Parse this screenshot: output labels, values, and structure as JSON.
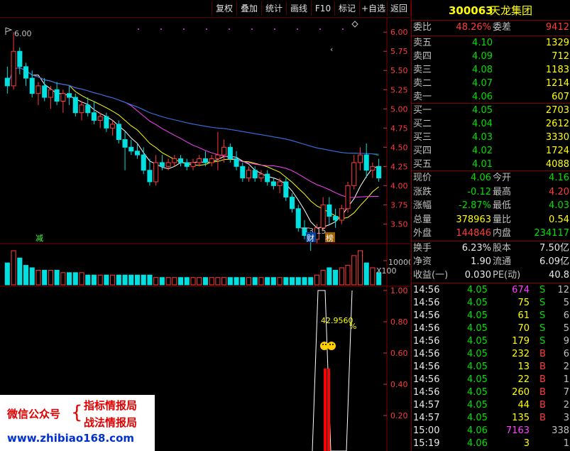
{
  "toolbar": {
    "buttons": [
      "复权",
      "叠加",
      "统计",
      "画线",
      "F10",
      "标记",
      "+自选",
      "返回"
    ]
  },
  "stock": {
    "code": "300063",
    "name": "天龙集团"
  },
  "order_ratio": {
    "label1": "委比",
    "value1": "48.26%",
    "label2": "委差",
    "value2": "9412"
  },
  "asks": [
    {
      "label": "卖五",
      "price": "4.10",
      "vol": "1329"
    },
    {
      "label": "卖四",
      "price": "4.09",
      "vol": "712"
    },
    {
      "label": "卖三",
      "price": "4.08",
      "vol": "1183"
    },
    {
      "label": "卖二",
      "price": "4.07",
      "vol": "1214"
    },
    {
      "label": "卖一",
      "price": "4.06",
      "vol": "607"
    }
  ],
  "bids": [
    {
      "label": "买一",
      "price": "4.05",
      "vol": "2703"
    },
    {
      "label": "买二",
      "price": "4.04",
      "vol": "2612"
    },
    {
      "label": "买三",
      "price": "4.03",
      "vol": "3330"
    },
    {
      "label": "买四",
      "price": "4.02",
      "vol": "1724"
    },
    {
      "label": "买五",
      "price": "4.01",
      "vol": "4088"
    }
  ],
  "quote": [
    {
      "l1": "现价",
      "v1": "4.06",
      "c1": "green",
      "l2": "今开",
      "v2": "4.16",
      "c2": "green"
    },
    {
      "l1": "涨跌",
      "v1": "-0.12",
      "c1": "green",
      "l2": "最高",
      "v2": "4.20",
      "c2": "red"
    },
    {
      "l1": "涨幅",
      "v1": "-2.87%",
      "c1": "green",
      "l2": "最低",
      "v2": "4.03",
      "c2": "green"
    },
    {
      "l1": "总量",
      "v1": "378963",
      "c1": "yellow",
      "l2": "量比",
      "v2": "0.54",
      "c2": "yellow"
    },
    {
      "l1": "外盘",
      "v1": "144846",
      "c1": "red",
      "l2": "内盘",
      "v2": "234117",
      "c2": "green"
    }
  ],
  "stats": [
    {
      "l1": "换手",
      "v1": "6.23%",
      "l2": "股本",
      "v2": "7.50亿"
    },
    {
      "l1": "净资",
      "v1": "1.90",
      "l2": "流通",
      "v2": "6.09亿"
    },
    {
      "l1": "收益(一)",
      "v1": "0.030",
      "l2": "PE(动)",
      "v2": "40.8"
    }
  ],
  "ticks": [
    {
      "time": "14:56",
      "price": "4.05",
      "vol": "674",
      "side": "S",
      "n": "12",
      "vcolor": "magenta"
    },
    {
      "time": "14:56",
      "price": "4.05",
      "vol": "75",
      "side": "S",
      "n": "5",
      "vcolor": "yellow"
    },
    {
      "time": "14:56",
      "price": "4.05",
      "vol": "61",
      "side": "S",
      "n": "6",
      "vcolor": "yellow"
    },
    {
      "time": "14:56",
      "price": "4.05",
      "vol": "70",
      "side": "S",
      "n": "5",
      "vcolor": "yellow"
    },
    {
      "time": "14:56",
      "price": "4.05",
      "vol": "179",
      "side": "S",
      "n": "9",
      "vcolor": "yellow"
    },
    {
      "time": "14:56",
      "price": "4.05",
      "vol": "232",
      "side": "B",
      "n": "6",
      "vcolor": "yellow"
    },
    {
      "time": "14:56",
      "price": "4.05",
      "vol": "13",
      "side": "B",
      "n": "2",
      "vcolor": "yellow"
    },
    {
      "time": "14:56",
      "price": "4.05",
      "vol": "22",
      "side": "B",
      "n": "1",
      "vcolor": "yellow"
    },
    {
      "time": "14:56",
      "price": "4.05",
      "vol": "260",
      "side": "B",
      "n": "7",
      "vcolor": "yellow"
    },
    {
      "time": "14:57",
      "price": "4.05",
      "vol": "44",
      "side": "B",
      "n": "2",
      "vcolor": "yellow"
    },
    {
      "time": "14:57",
      "price": "4.05",
      "vol": "135",
      "side": "B",
      "n": "3",
      "vcolor": "yellow"
    },
    {
      "time": "15:00",
      "price": "4.06",
      "vol": "7163",
      "side": "",
      "n": "338",
      "vcolor": "magenta"
    },
    {
      "time": "15:19",
      "price": "4.06",
      "vol": "3",
      "side": "",
      "n": "1",
      "vcolor": "yellow"
    }
  ],
  "chart_data": [
    {
      "type": "candlestick",
      "price_ticks": [
        "6.00",
        "5.75",
        "5.50",
        "5.25",
        "5.00",
        "4.75",
        "4.50",
        "4.25",
        "4.00",
        "3.75",
        "3.50"
      ],
      "ylim": [
        3.3,
        6.15
      ],
      "high_label": "6.00",
      "low_label": "3.15",
      "markers": [
        "减",
        "财",
        "榜"
      ],
      "ohlc": [
        [
          5.4,
          5.55,
          5.2,
          5.3
        ],
        [
          5.3,
          6.0,
          5.25,
          5.75
        ],
        [
          5.75,
          5.8,
          5.45,
          5.55
        ],
        [
          5.55,
          5.6,
          5.3,
          5.4
        ],
        [
          5.4,
          5.5,
          5.15,
          5.2
        ],
        [
          5.2,
          5.35,
          5.05,
          5.3
        ],
        [
          5.3,
          5.4,
          5.1,
          5.15
        ],
        [
          5.15,
          5.3,
          5.0,
          5.25
        ],
        [
          5.25,
          5.35,
          5.05,
          5.1
        ],
        [
          5.1,
          5.25,
          4.95,
          5.2
        ],
        [
          5.2,
          5.3,
          5.05,
          5.15
        ],
        [
          5.15,
          5.2,
          4.9,
          4.95
        ],
        [
          4.95,
          5.1,
          4.85,
          5.05
        ],
        [
          5.05,
          5.15,
          4.9,
          4.95
        ],
        [
          4.95,
          5.1,
          4.8,
          4.85
        ],
        [
          4.85,
          4.95,
          4.75,
          4.9
        ],
        [
          4.9,
          4.95,
          4.7,
          4.75
        ],
        [
          4.75,
          4.85,
          4.65,
          4.8
        ],
        [
          4.8,
          4.85,
          4.55,
          4.6
        ],
        [
          4.6,
          4.7,
          4.2,
          4.5
        ],
        [
          4.5,
          4.6,
          4.4,
          4.45
        ],
        [
          4.45,
          4.55,
          4.35,
          4.4
        ],
        [
          4.4,
          4.5,
          4.15,
          4.2
        ],
        [
          4.2,
          4.35,
          4.0,
          4.05
        ],
        [
          4.05,
          4.4,
          4.0,
          4.3
        ],
        [
          4.3,
          4.4,
          4.2,
          4.25
        ],
        [
          4.25,
          4.35,
          4.2,
          4.3
        ],
        [
          4.3,
          4.4,
          4.25,
          4.35
        ],
        [
          4.35,
          4.4,
          4.25,
          4.3
        ],
        [
          4.3,
          4.35,
          4.2,
          4.25
        ],
        [
          4.25,
          4.35,
          4.2,
          4.3
        ],
        [
          4.3,
          4.4,
          4.25,
          4.35
        ],
        [
          4.35,
          4.45,
          4.25,
          4.3
        ],
        [
          4.3,
          4.4,
          4.25,
          4.35
        ],
        [
          4.35,
          4.7,
          4.2,
          4.4
        ],
        [
          4.4,
          4.6,
          4.3,
          4.5
        ],
        [
          4.5,
          4.55,
          4.3,
          4.35
        ],
        [
          4.35,
          4.45,
          4.2,
          4.25
        ],
        [
          4.25,
          4.3,
          4.05,
          4.1
        ],
        [
          4.1,
          4.25,
          4.05,
          4.2
        ],
        [
          4.2,
          4.25,
          4.05,
          4.1
        ],
        [
          4.1,
          4.2,
          4.05,
          4.15
        ],
        [
          4.15,
          4.2,
          4.0,
          4.05
        ],
        [
          4.05,
          4.1,
          3.95,
          4.0
        ],
        [
          4.0,
          4.1,
          3.9,
          4.05
        ],
        [
          4.05,
          4.1,
          3.8,
          3.85
        ],
        [
          3.85,
          3.9,
          3.65,
          3.7
        ],
        [
          3.7,
          3.75,
          3.4,
          3.45
        ],
        [
          3.45,
          3.55,
          3.3,
          3.35
        ],
        [
          3.35,
          3.4,
          3.15,
          3.3
        ],
        [
          3.3,
          3.5,
          3.25,
          3.45
        ],
        [
          3.45,
          3.85,
          3.4,
          3.75
        ],
        [
          3.75,
          3.85,
          3.5,
          3.6
        ],
        [
          3.6,
          3.7,
          3.45,
          3.55
        ],
        [
          3.55,
          3.75,
          3.5,
          3.7
        ],
        [
          3.7,
          4.05,
          3.65,
          4.0
        ],
        [
          4.0,
          4.4,
          3.95,
          4.3
        ],
        [
          4.3,
          4.5,
          4.2,
          4.4
        ],
        [
          4.4,
          4.55,
          4.1,
          4.2
        ],
        [
          4.2,
          4.3,
          4.1,
          4.25
        ],
        [
          4.25,
          4.35,
          4.05,
          4.1
        ]
      ]
    },
    {
      "type": "bar",
      "axis_labels": [
        "10000",
        "X100"
      ],
      "volume": [
        9,
        14,
        11,
        8,
        7,
        6,
        6,
        6,
        6,
        5,
        5,
        5,
        5,
        4,
        4,
        4,
        4,
        4,
        4,
        4,
        4,
        4,
        4,
        4,
        3,
        3,
        3,
        3,
        3,
        3,
        3,
        3,
        3,
        3,
        3,
        3,
        3,
        3,
        3,
        3,
        3,
        3,
        3,
        3,
        3,
        3,
        3,
        3,
        3,
        3,
        4,
        6,
        7,
        6,
        7,
        8,
        12,
        14,
        9,
        7,
        5
      ]
    },
    {
      "type": "line",
      "yticks": [
        "1.00",
        "0.80",
        "0.60",
        "0.40",
        "0.20"
      ],
      "ylim": [
        0,
        1.0
      ],
      "annotations": [
        "42.9560",
        "%"
      ],
      "red_bars": [
        0.5,
        0.5
      ]
    }
  ],
  "watermark": {
    "line1": "微信公众号",
    "tag1": "指标情报局",
    "tag2": "战法情报局",
    "url": "www.zhibiao168.com"
  }
}
